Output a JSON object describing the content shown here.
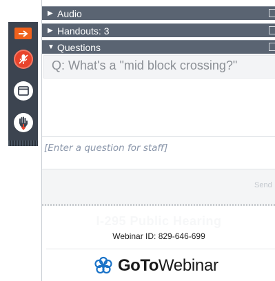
{
  "panel": {
    "sections": [
      {
        "label": "Audio",
        "expanded": false
      },
      {
        "label": "Handouts: 3",
        "expanded": false
      },
      {
        "label": "Questions",
        "expanded": true
      }
    ],
    "question_log": "Q: What's a \"mid block crossing?\"",
    "question_input_placeholder": "[Enter a question for staff]",
    "send_label": "Send"
  },
  "footer": {
    "webinar_title": "I-295 Public Hearing",
    "webinar_id": "Webinar ID: 829-646-699",
    "logo_goto": "GoTo",
    "logo_webinar": "Webinar"
  },
  "icons": {
    "grab_tab": "arrow-right-icon",
    "mic": "microphone-muted-icon",
    "screen": "window-icon",
    "hand": "raise-hand-icon"
  },
  "colors": {
    "accent_orange": "#f0611c",
    "mic_red": "#e8432b",
    "header_bg": "#5a6472",
    "logo_blue": "#1a73c8"
  }
}
